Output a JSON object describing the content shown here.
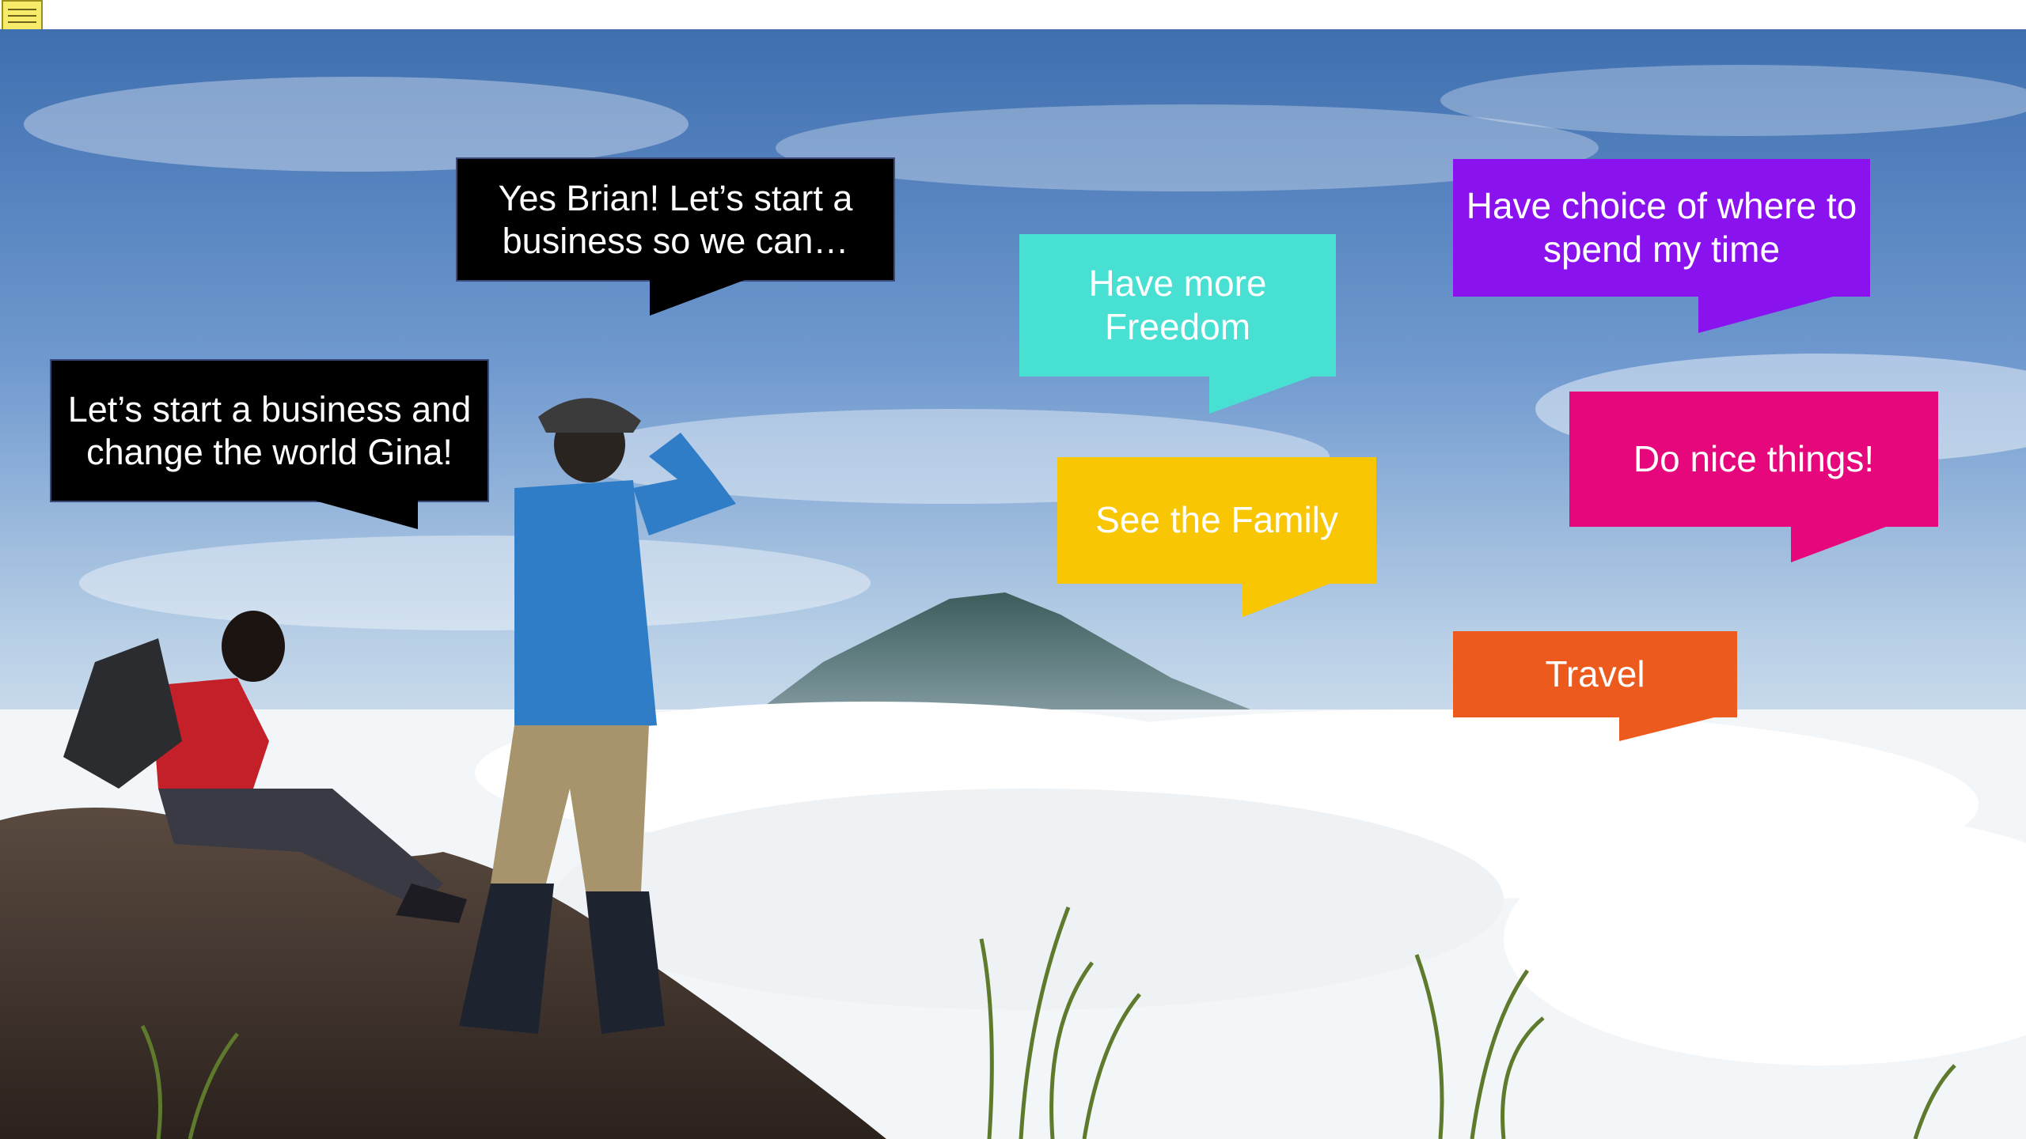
{
  "toolbar": {
    "note_icon": "sticky-note-icon"
  },
  "slide": {
    "background": "mountain-summit-hikers-photo",
    "bubbles": {
      "brian": {
        "text": "Yes Brian! Let’s start a business so we can…",
        "color": "#000000"
      },
      "gina": {
        "text": "Let’s start a business and change the world Gina!",
        "color": "#000000"
      },
      "freedom": {
        "text": "Have more Freedom",
        "color": "#47e0d2"
      },
      "choice": {
        "text": "Have choice of where to spend my time",
        "color": "#8a12ef"
      },
      "family": {
        "text": "See the Family",
        "color": "#f8c603"
      },
      "nice": {
        "text": "Do nice things!",
        "color": "#e5077b"
      },
      "travel": {
        "text": "Travel",
        "color": "#ec5a1e"
      }
    }
  }
}
